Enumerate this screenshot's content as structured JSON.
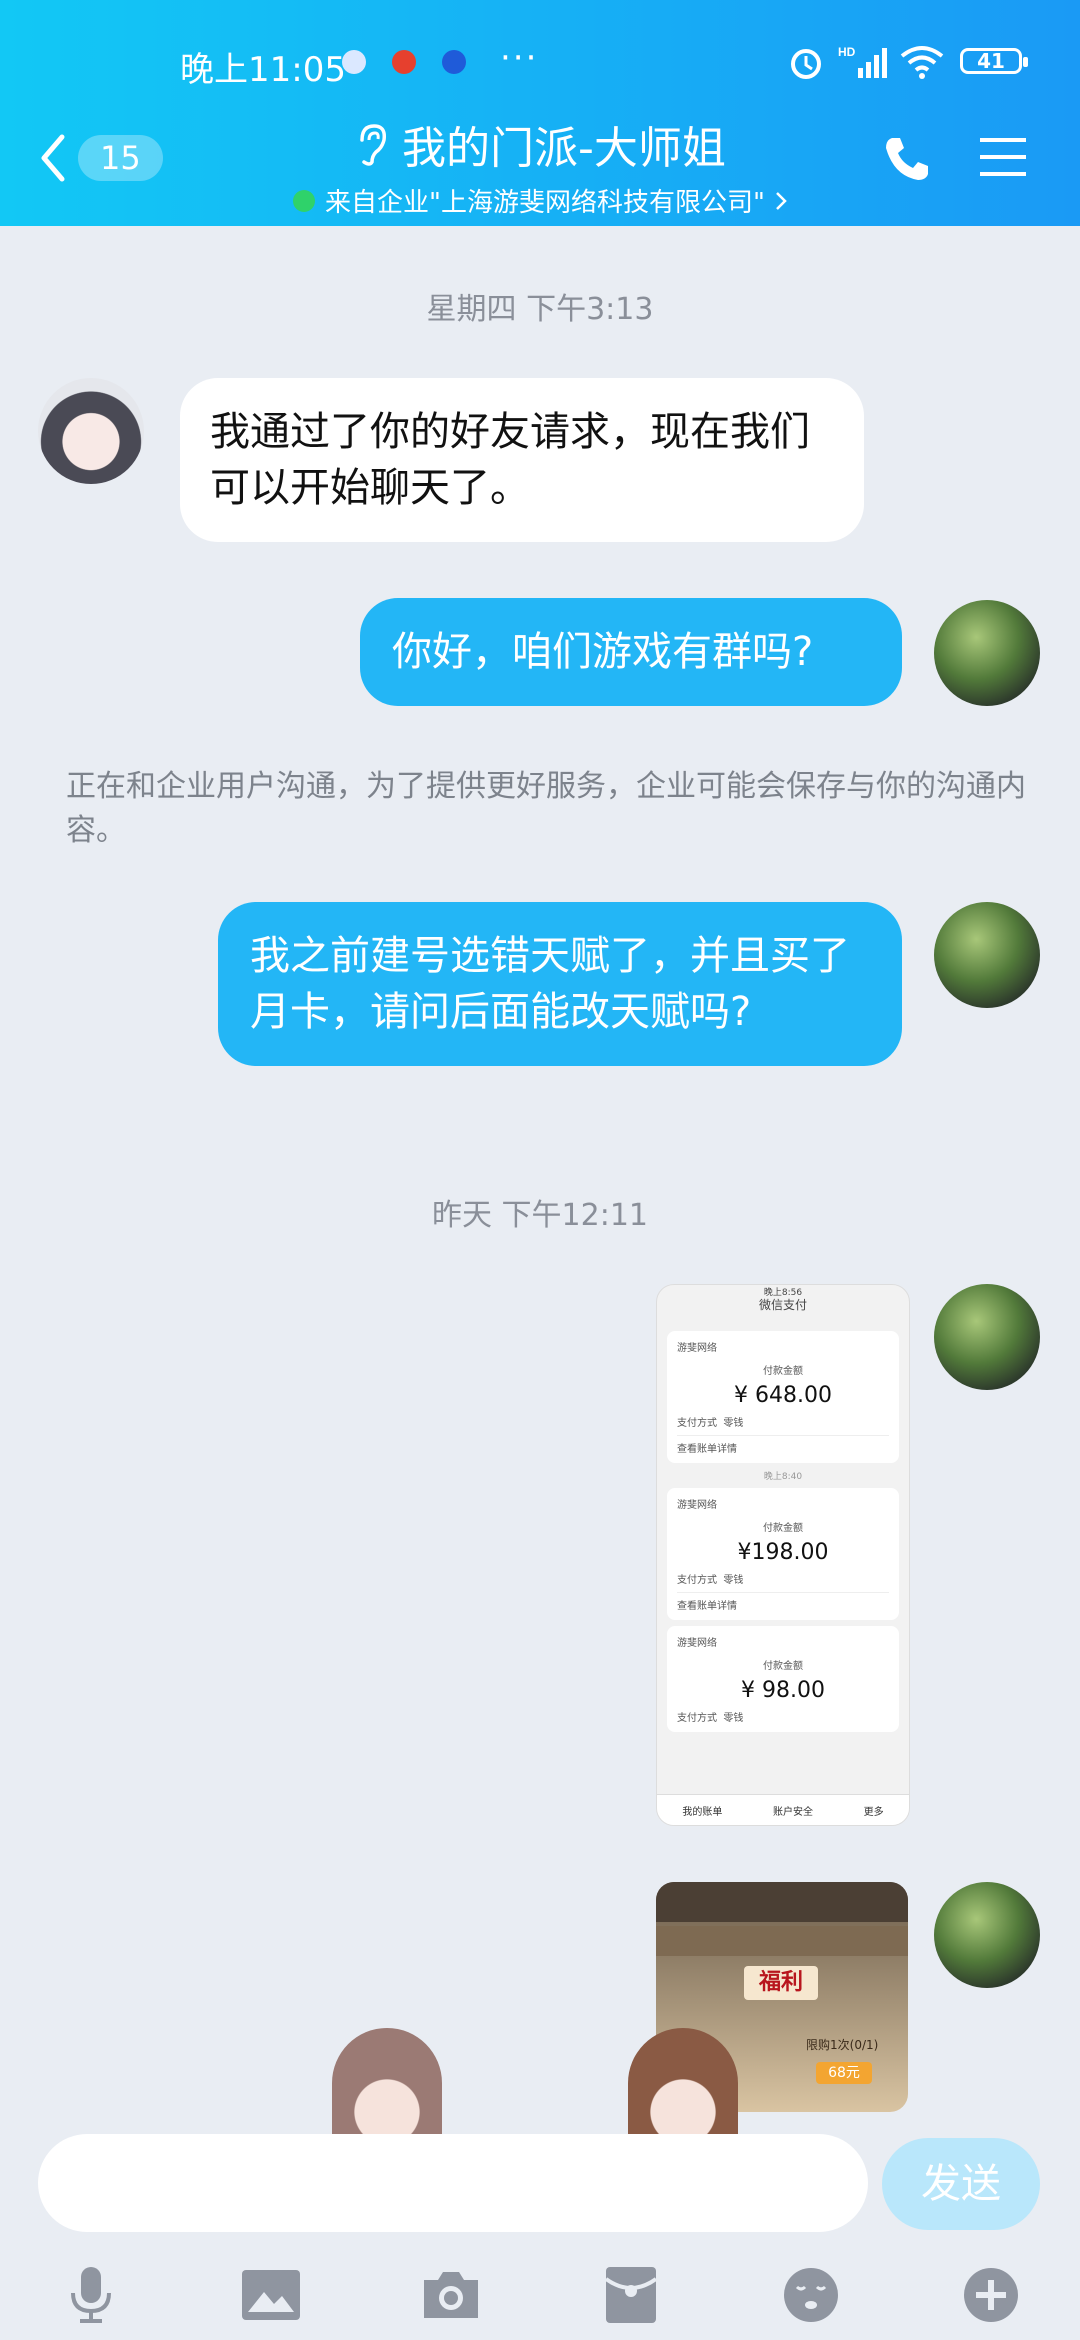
{
  "status_bar": {
    "time": "晚上11:05",
    "dots": "···",
    "network": "HD",
    "battery": "41"
  },
  "header": {
    "back_badge": "15",
    "title": "我的门派-大师姐",
    "subtitle": "来自企业\"上海游斐网络科技有限公司\""
  },
  "messages": {
    "time1": "星期四 下午3:13",
    "left_msg": "我通过了你的好友请求，现在我们可以开始聊天了。",
    "right_msg1": "你好，咱们游戏有群吗?",
    "notice": "正在和企业用户沟通，为了提供更好服务，企业可能会保存与你的沟通内容。",
    "right_msg2": "我之前建号选错天赋了，并且买了月卡，请问后面能改天赋吗?",
    "time2": "昨天 下午12:11"
  },
  "payment_screenshot": {
    "status": "晚上8:56",
    "title": "微信支付",
    "payments": [
      {
        "merchant": "游斐网络",
        "label": "付款金额",
        "amount": "¥ 648.00",
        "method_label": "支付方式",
        "method": "零钱",
        "detail": "查看账单详情"
      },
      {
        "merchant": "游斐网络",
        "label": "付款金额",
        "amount": "¥198.00",
        "method_label": "支付方式",
        "method": "零钱",
        "detail": "查看账单详情"
      },
      {
        "merchant": "游斐网络",
        "label": "付款金额",
        "amount": "¥ 98.00",
        "method_label": "支付方式",
        "method": "零钱"
      }
    ],
    "separator_time": "晚上8:40",
    "bottom_tabs": [
      "我的账单",
      "账户安全",
      "更多"
    ]
  },
  "game_screenshot": {
    "banner": "福利",
    "price": "68元",
    "limit": "限购1次(0/1)"
  },
  "input": {
    "placeholder": "",
    "send": "发送"
  },
  "colors": {
    "header_start": "#12c8f5",
    "header_end": "#1a9af5",
    "bubble_right": "#23b6f6",
    "send_disabled": "#b9e7fb"
  }
}
